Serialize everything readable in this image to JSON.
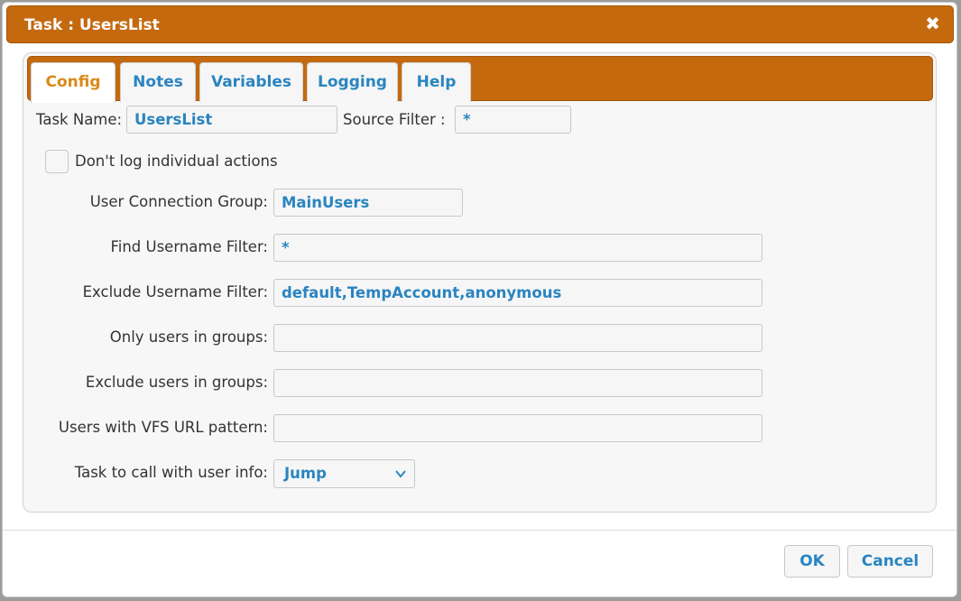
{
  "dialog": {
    "title": "Task : UsersList",
    "close_icon": "close-icon",
    "close_glyph": "✖"
  },
  "tabs": [
    {
      "label": "Config",
      "active": true
    },
    {
      "label": "Notes",
      "active": false
    },
    {
      "label": "Variables",
      "active": false
    },
    {
      "label": "Logging",
      "active": false
    },
    {
      "label": "Help",
      "active": false
    }
  ],
  "form": {
    "task_name_label": "Task Name:",
    "task_name_value": "UsersList",
    "source_filter_label": "Source Filter :",
    "source_filter_value": "*",
    "dont_log_label": "Don't log individual actions",
    "dont_log_checked": false,
    "fields": [
      {
        "label": "User Connection Group:",
        "value": "MainUsers"
      },
      {
        "label": "Find Username Filter:",
        "value": "*"
      },
      {
        "label": "Exclude Username Filter:",
        "value": "default,TempAccount,anonymous"
      },
      {
        "label": "Only users in groups:",
        "value": ""
      },
      {
        "label": "Exclude users in groups:",
        "value": ""
      },
      {
        "label": "Users with VFS URL pattern:",
        "value": ""
      }
    ],
    "task_call_label": "Task to call with user info:",
    "task_call_value": "Jump"
  },
  "footer": {
    "ok_label": "OK",
    "cancel_label": "Cancel"
  },
  "colors": {
    "accent": "#c5690f",
    "link_text": "#2a85c0",
    "active_tab_text": "#d98a17"
  }
}
